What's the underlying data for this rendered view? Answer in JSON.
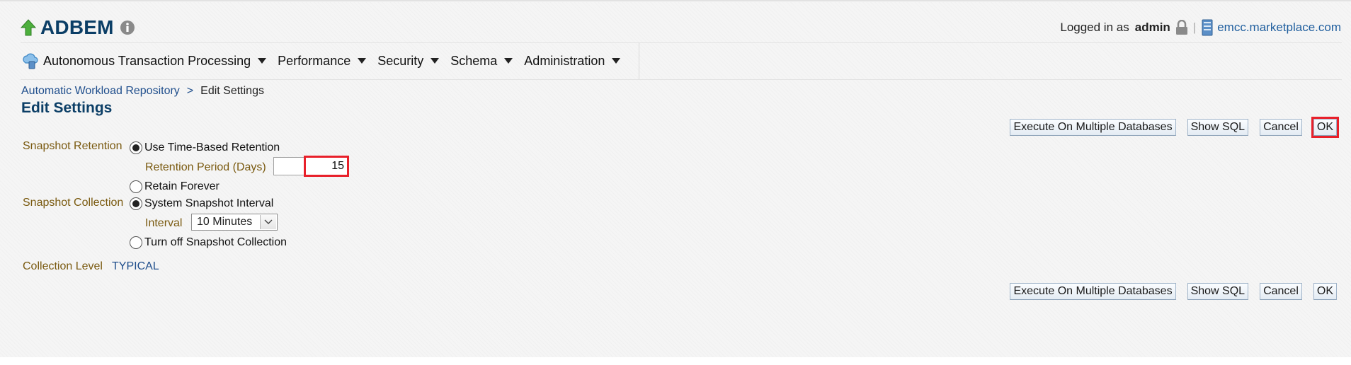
{
  "header": {
    "db_name": "ADBEM",
    "logged_in_label": "Logged in as",
    "user": "admin",
    "host": "emcc.marketplace.com"
  },
  "menu": [
    {
      "label": "Autonomous Transaction Processing"
    },
    {
      "label": "Performance"
    },
    {
      "label": "Security"
    },
    {
      "label": "Schema"
    },
    {
      "label": "Administration"
    }
  ],
  "breadcrumb": {
    "parent": "Automatic Workload Repository",
    "separator": ">",
    "current": "Edit Settings"
  },
  "page_title": "Edit Settings",
  "buttons": {
    "execute": "Execute On Multiple Databases",
    "show_sql": "Show SQL",
    "cancel": "Cancel",
    "ok": "OK"
  },
  "form": {
    "snapshot_retention_label": "Snapshot Retention",
    "use_time_based": "Use Time-Based Retention",
    "retention_period_label": "Retention Period (Days)",
    "retention_period_value": "15",
    "retain_forever": "Retain Forever",
    "snapshot_collection_label": "Snapshot Collection",
    "system_interval": "System Snapshot Interval",
    "interval_label": "Interval",
    "interval_value": "10 Minutes",
    "turn_off": "Turn off Snapshot Collection",
    "collection_level_label": "Collection Level",
    "collection_level_value": "TYPICAL"
  },
  "colors": {
    "title_blue": "#0b3e66",
    "link_blue": "#1f4e8c",
    "label_gold": "#7a5a10",
    "highlight_red": "#e8202a"
  },
  "icons": [
    "up-arrow-icon",
    "info-icon",
    "lock-icon",
    "server-icon",
    "cloud-database-icon",
    "chevron-down-icon"
  ]
}
